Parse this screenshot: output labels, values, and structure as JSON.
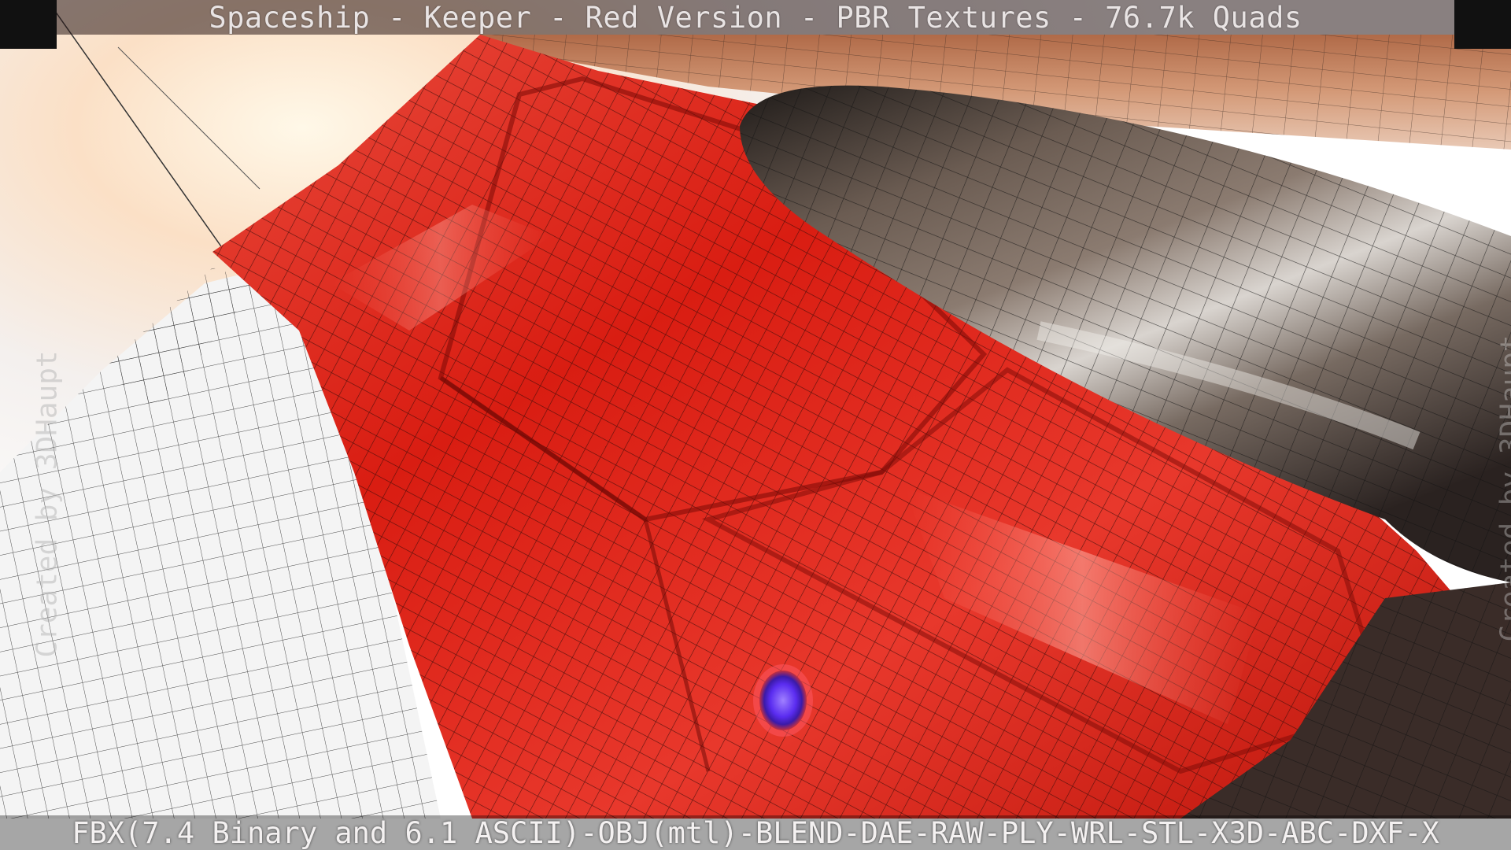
{
  "title": "Spaceship - Keeper - Red Version - PBR Textures - 76.7k Quads",
  "formats": "FBX(7.4 Binary and 6.1 ASCII)-OBJ(mtl)-BLEND-DAE-RAW-PLY-WRL-STL-X3D-ABC-DXF-X",
  "watermark": "Created by 3DHaupt",
  "colors": {
    "hull_red": "#e0251c",
    "cockpit_dark": "#4a3b34",
    "light_glow": "#6a3cff",
    "background": "#ffffff"
  }
}
